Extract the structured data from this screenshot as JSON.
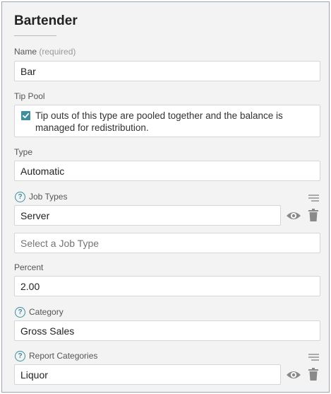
{
  "form": {
    "title": "Bartender",
    "name": {
      "label": "Name",
      "hint": "(required)",
      "value": "Bar"
    },
    "tip_pool": {
      "label": "Tip Pool",
      "checked": true,
      "text": "Tip outs of this type are pooled together and the balance is managed for redistribution."
    },
    "type": {
      "label": "Type",
      "value": "Automatic"
    },
    "job_types": {
      "label": "Job Types",
      "items": [
        "Server"
      ],
      "placeholder": "Select a Job Type"
    },
    "percent": {
      "label": "Percent",
      "value": "2.00"
    },
    "category": {
      "label": "Category",
      "value": "Gross Sales"
    },
    "report_categories": {
      "label": "Report Categories",
      "items": [
        "Liquor"
      ]
    }
  },
  "colors": {
    "accent": "#3e8e9e",
    "icon_gray": "#8a8a8a",
    "background": "#f3f3f3",
    "field_border": "#d6d6d6"
  },
  "icons": {
    "help": "help-circle-icon",
    "reorder": "reorder-lines-icon",
    "visibility": "eye-icon",
    "delete": "trash-icon",
    "checkbox": "checkmark-icon"
  }
}
